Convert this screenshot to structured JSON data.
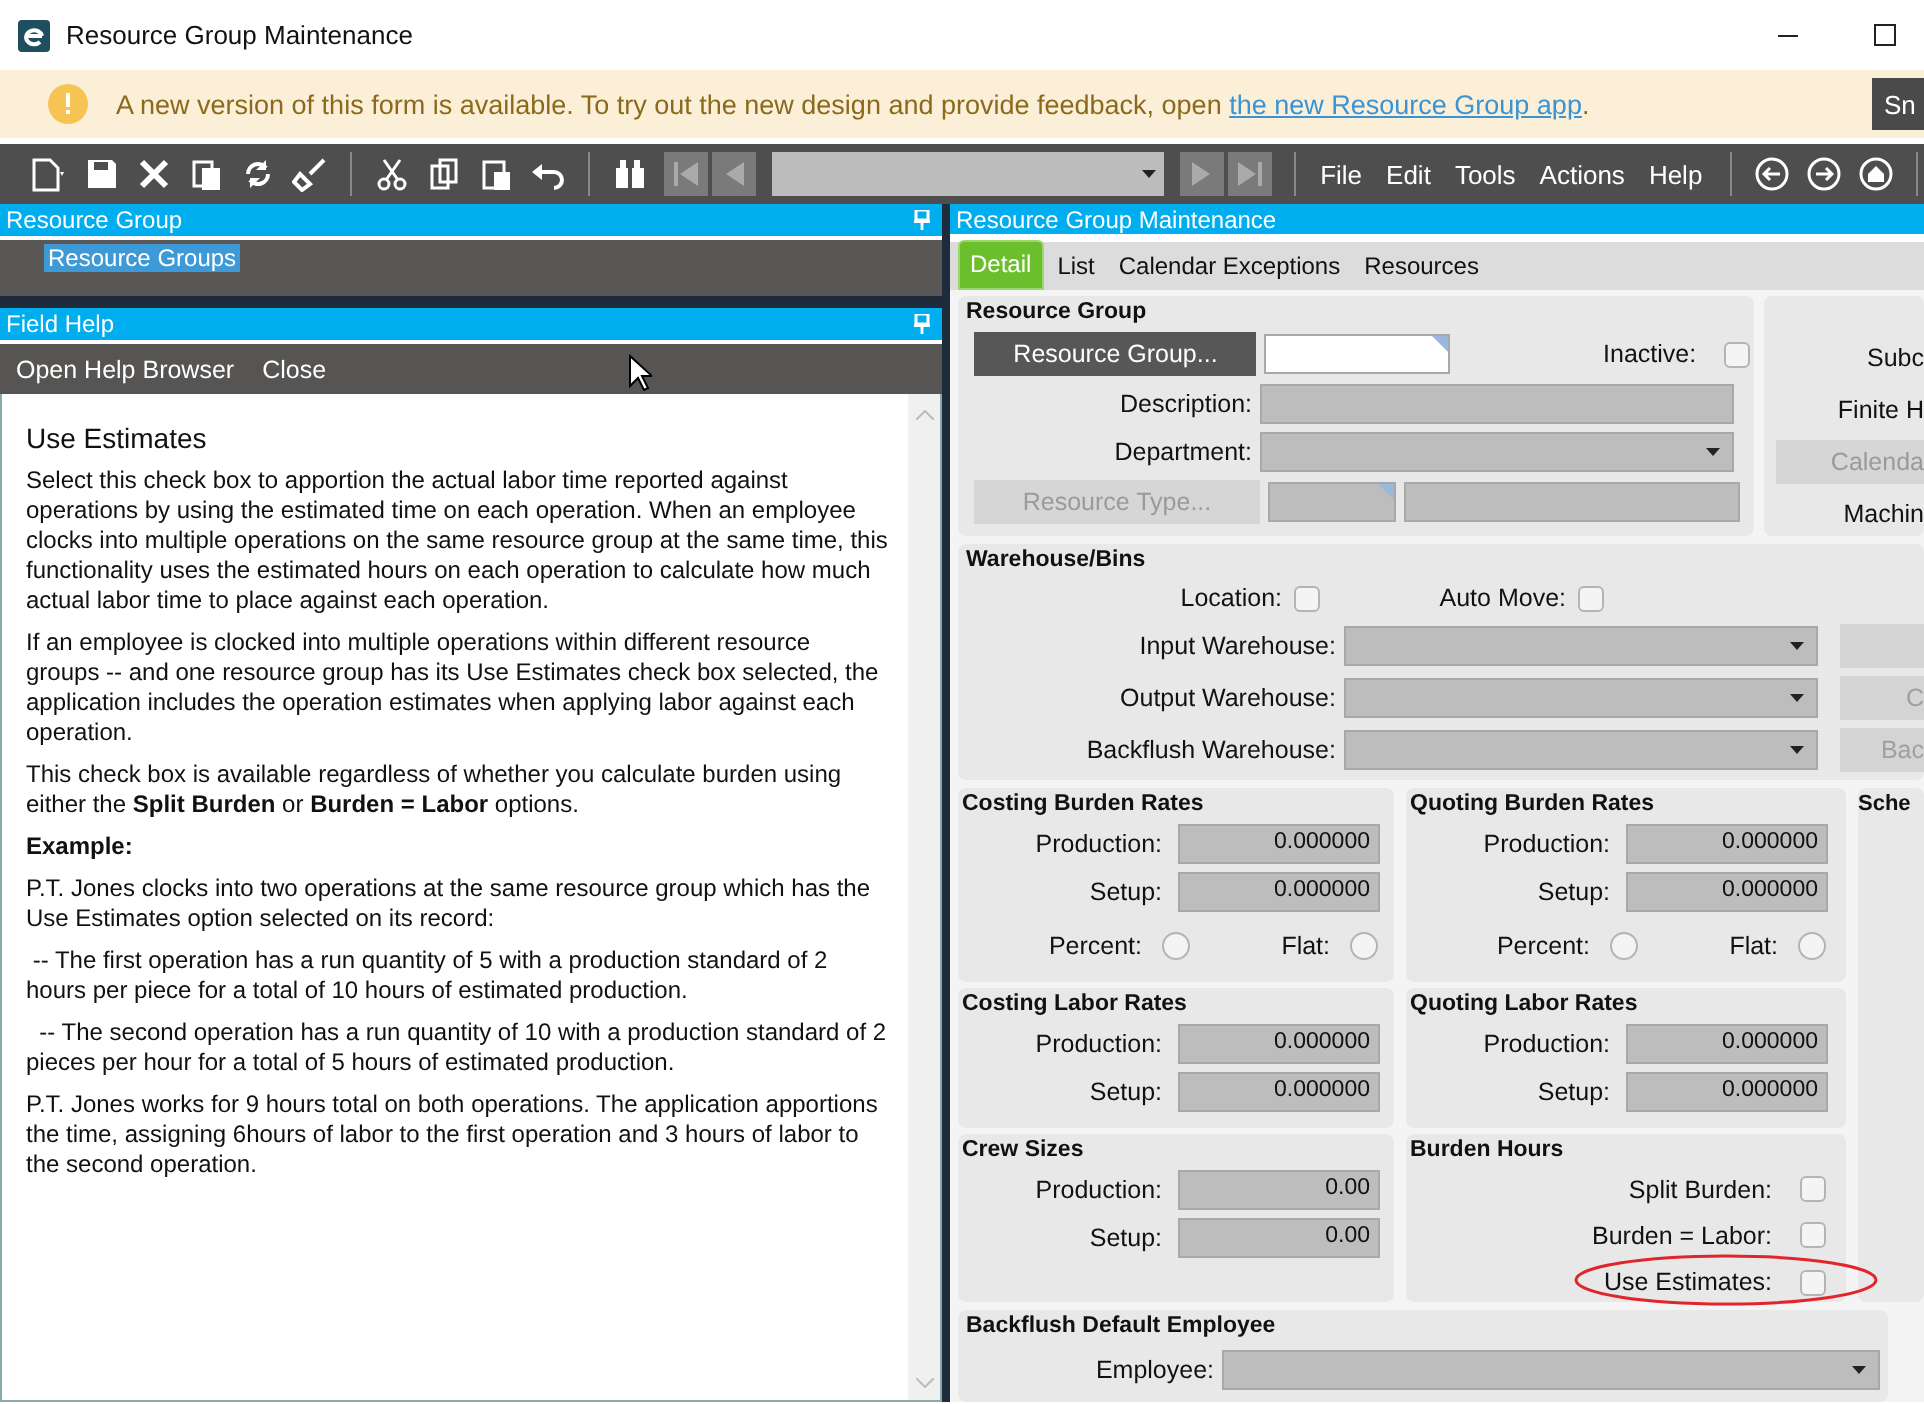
{
  "window": {
    "title": "Resource Group Maintenance"
  },
  "banner": {
    "message": "A new version of this form is available. To try out the new design and provide feedback, open ",
    "link": "the new Resource Group app",
    "end": ".",
    "button": "Sn"
  },
  "toolbar": {
    "menus": [
      "File",
      "Edit",
      "Tools",
      "Actions",
      "Help"
    ]
  },
  "resource_group_panel": {
    "title": "Resource Group",
    "items": [
      {
        "label": "Resource Groups",
        "selected": true
      }
    ]
  },
  "field_help": {
    "title": "Field Help",
    "actions": [
      "Open Help Browser",
      "Close"
    ],
    "heading": "Use Estimates",
    "paragraphs": [
      {
        "kind": "text",
        "text": "Select this check box to apportion the actual labor time reported against operations by using the estimated time on each operation. When an employee clocks into multiple operations on the same resource group at the same time, this functionality uses the estimated hours on each operation to calculate how much actual labor time to place against each operation."
      },
      {
        "kind": "text",
        "text": "If an employee is clocked into multiple operations within different resource groups -- and one resource group has its Use Estimates check box selected, the application includes the operation estimates when applying labor against each operation."
      },
      {
        "kind": "text",
        "text": "This check box is available regardless of whether you calculate burden using either the **Split Burden** or **Burden = Labor** options."
      },
      {
        "kind": "subheading",
        "text": "Example:"
      },
      {
        "kind": "text",
        "text": "P.T. Jones clocks into two operations at the same resource group which has the Use Estimates option selected on its record:"
      },
      {
        "kind": "text",
        "text": " -- The first operation has a run quantity of 5 with a production standard of 2 hours per piece for a total of 10 hours of estimated production."
      },
      {
        "kind": "text",
        "text": "  -- The second operation has a run quantity of 10 with a production standard of 2 pieces per hour for a total of 5 hours of estimated production."
      },
      {
        "kind": "text",
        "text": "P.T. Jones works for 9 hours total on both operations. The application apportions the time, assigning 6hours of labor to the first operation and 3 hours of labor to the second operation."
      }
    ]
  },
  "form": {
    "title": "Resource Group Maintenance",
    "tabs": [
      {
        "label": "Detail",
        "selected": true
      },
      {
        "label": "List",
        "selected": false
      },
      {
        "label": "Calendar Exceptions",
        "selected": false
      },
      {
        "label": "Resources",
        "selected": false
      }
    ],
    "resource_group": {
      "title": "Resource Group",
      "button": "Resource Group...",
      "inactive": {
        "label": "Inactive:",
        "checked": false
      },
      "description_label": "Description:",
      "department_label": "Department:",
      "type_button": "Resource Type..."
    },
    "side_panel": [
      {
        "kind": "label",
        "text": "Subc"
      },
      {
        "kind": "label",
        "text": "Finite H"
      },
      {
        "kind": "button",
        "text": "Calenda"
      },
      {
        "kind": "label",
        "text": "Machin"
      }
    ],
    "warehouse": {
      "title": "Warehouse/Bins",
      "checks": [
        {
          "label": "Location:",
          "checked": false
        },
        {
          "label": "Auto Move:",
          "checked": false
        }
      ],
      "dropdowns": [
        {
          "label": "Input Warehouse:"
        },
        {
          "label": "Output Warehouse:",
          "side_button": "C"
        },
        {
          "label": "Backflush Warehouse:",
          "side_button": "Bac"
        }
      ]
    },
    "panels": [
      {
        "kind": "fields",
        "title": "Costing Burden Rates",
        "fields": [
          {
            "label": "Production:",
            "value": "0.000000"
          },
          {
            "label": "Setup:",
            "value": "0.000000"
          }
        ],
        "radios": [
          {
            "label": "Percent:",
            "selected": false
          },
          {
            "label": "Flat:",
            "selected": false
          }
        ]
      },
      {
        "kind": "fields",
        "title": "Quoting Burden Rates",
        "fields": [
          {
            "label": "Production:",
            "value": "0.000000"
          },
          {
            "label": "Setup:",
            "value": "0.000000"
          }
        ],
        "radios": [
          {
            "label": "Percent:",
            "selected": false
          },
          {
            "label": "Flat:",
            "selected": false
          }
        ]
      },
      {
        "kind": "fields",
        "title": "Costing Labor Rates",
        "fields": [
          {
            "label": "Production:",
            "value": "0.000000"
          },
          {
            "label": "Setup:",
            "value": "0.000000"
          }
        ]
      },
      {
        "kind": "fields",
        "title": "Quoting Labor Rates",
        "fields": [
          {
            "label": "Production:",
            "value": "0.000000"
          },
          {
            "label": "Setup:",
            "value": "0.000000"
          }
        ]
      },
      {
        "kind": "fields",
        "title": "Crew Sizes",
        "fields": [
          {
            "label": "Production:",
            "value": "0.00"
          },
          {
            "label": "Setup:",
            "value": "0.00"
          }
        ]
      },
      {
        "kind": "checks",
        "title": "Burden Hours",
        "checks": [
          {
            "label": "Split Burden:",
            "checked": false
          },
          {
            "label": "Burden = Labor:",
            "checked": false
          },
          {
            "label": "Use Estimates:",
            "checked": false
          }
        ]
      }
    ],
    "schedule_panel": {
      "title": "Sche"
    },
    "backflush": {
      "title": "Backflush Default Employee",
      "label": "Employee:"
    }
  }
}
